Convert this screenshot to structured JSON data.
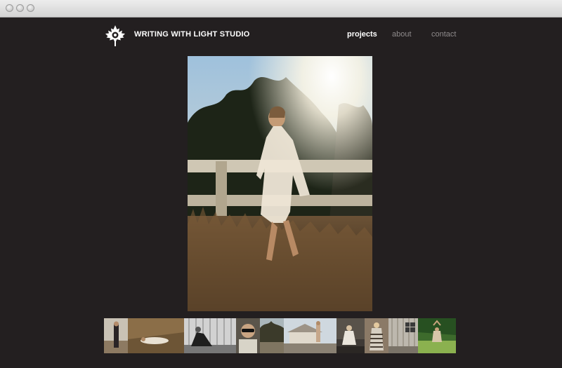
{
  "window": {
    "buttons": [
      "close",
      "minimize",
      "zoom"
    ]
  },
  "header": {
    "logo_icon": "maple-leaf-icon",
    "brand_name": "WRITING WITH LIGHT STUDIO"
  },
  "nav": {
    "items": [
      {
        "label": "projects",
        "active": true
      },
      {
        "label": "about",
        "active": false
      },
      {
        "label": "contact",
        "active": false
      }
    ]
  },
  "colors": {
    "background": "#231f20",
    "nav_active": "#ffffff",
    "nav_inactive": "#8e8a8b"
  },
  "hero": {
    "subject": "woman-in-white-dress-by-fence-photo"
  },
  "thumbnails": [
    {
      "subject": "woman-standing-beach-photo"
    },
    {
      "subject": "woman-lying-in-grass-photo"
    },
    {
      "subject": "woman-sitting-by-wall-bw-photo"
    },
    {
      "subject": "woman-sunglasses-portrait-photo"
    },
    {
      "subject": "house-with-trees-photo"
    },
    {
      "subject": "woman-by-barn-photo"
    },
    {
      "subject": "woman-sitting-by-wall-photo"
    },
    {
      "subject": "woman-in-striped-dress-photo"
    },
    {
      "subject": "woman-by-white-shed-photo"
    },
    {
      "subject": "yoga-in-field-photo"
    }
  ]
}
